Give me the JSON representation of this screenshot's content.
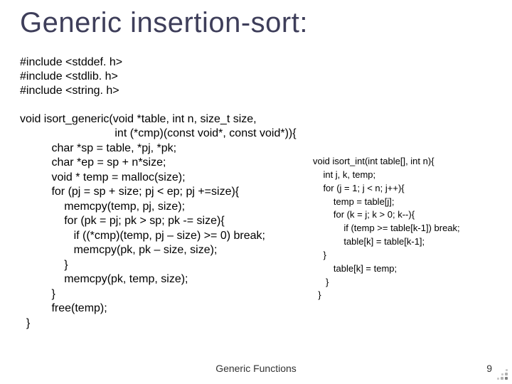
{
  "title": "Generic insertion-sort:",
  "includes": "#include <stddef. h>\n#include <stdlib. h>\n#include <string. h>",
  "main_code": "void isort_generic(void *table, int n, size_t size,\n                              int (*cmp)(const void*, const void*)){\n          char *sp = table, *pj, *pk;\n          char *ep = sp + n*size;\n          void * temp = malloc(size);\n          for (pj = sp + size; pj < ep; pj +=size){\n              memcpy(temp, pj, size);\n              for (pk = pj; pk > sp; pk -= size){\n                 if ((*cmp)(temp, pj – size) >= 0) break;\n                 memcpy(pk, pk – size, size);\n              }\n              memcpy(pk, temp, size);\n          }\n          free(temp);\n  }",
  "side_code": "void isort_int(int table[], int n){\n    int j, k, temp;\n    for (j = 1; j < n; j++){\n        temp = table[j];\n        for (k = j; k > 0; k--){\n            if (temp >= table[k-1]) break;\n            table[k] = table[k-1];\n    }\n        table[k] = temp;\n     }\n  }",
  "footer_center": "Generic Functions",
  "footer_right": "9"
}
